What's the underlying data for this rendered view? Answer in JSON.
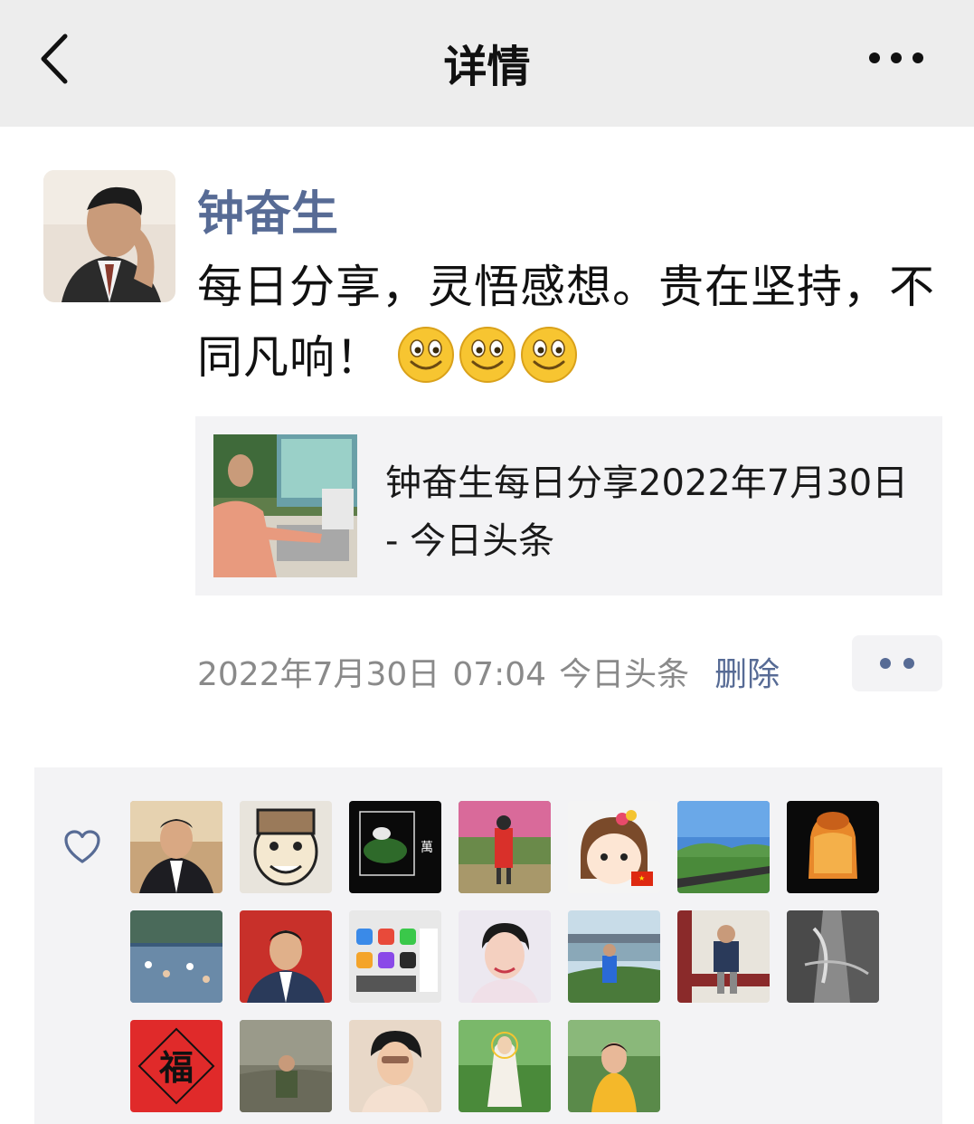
{
  "nav": {
    "title": "详情",
    "back_icon": "chevron-left-icon",
    "more_icon": "more-horizontal-icon"
  },
  "post": {
    "author": "钟奋生",
    "text": "每日分享，灵悟感想。贵在坚持，不同凡响！",
    "emojis": [
      "smile-emoji",
      "smile-emoji",
      "smile-emoji"
    ],
    "link_card": {
      "title": "钟奋生每日分享2022年7月30日 - 今日头条"
    },
    "meta": {
      "date": "2022年7月30日",
      "time": "07:04",
      "source": "今日头条",
      "delete_label": "删除"
    }
  },
  "likes": {
    "icon": "heart-outline-icon",
    "avatar_count": 19
  },
  "colors": {
    "nav_bg": "#ededed",
    "link_blue": "#576b95",
    "card_bg": "#f3f3f5",
    "meta_gray": "#8a8a8a"
  }
}
